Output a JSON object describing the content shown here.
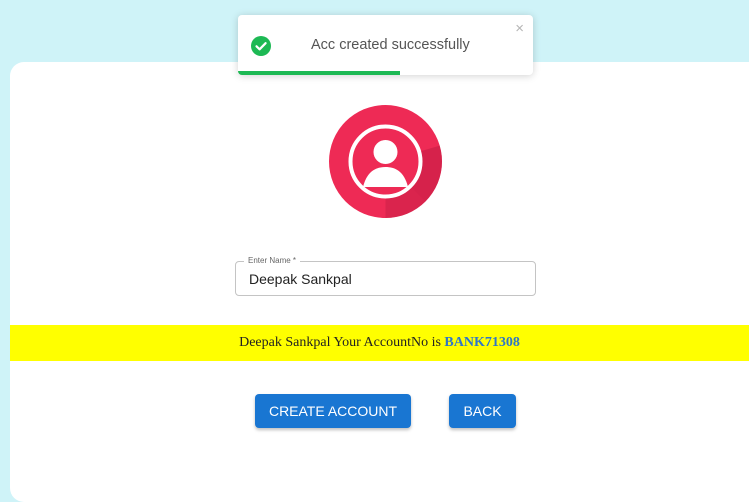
{
  "toast": {
    "message": "Acc created successfully",
    "close_symbol": "×",
    "progress": 0.55,
    "icon": "check-circle-icon",
    "accent": "#1db954"
  },
  "avatar": {
    "icon": "user-avatar-icon",
    "color": "#ee2a55"
  },
  "form": {
    "name_label": "Enter Name *",
    "name_value": "Deepak Sankpal"
  },
  "banner": {
    "text_prefix": "Deepak Sankpal Your AccountNo is",
    "account_no": "BANK71308",
    "background": "#ffff00"
  },
  "buttons": {
    "create_label": "CREATE ACCOUNT",
    "back_label": "BACK",
    "color": "#1976d2"
  }
}
